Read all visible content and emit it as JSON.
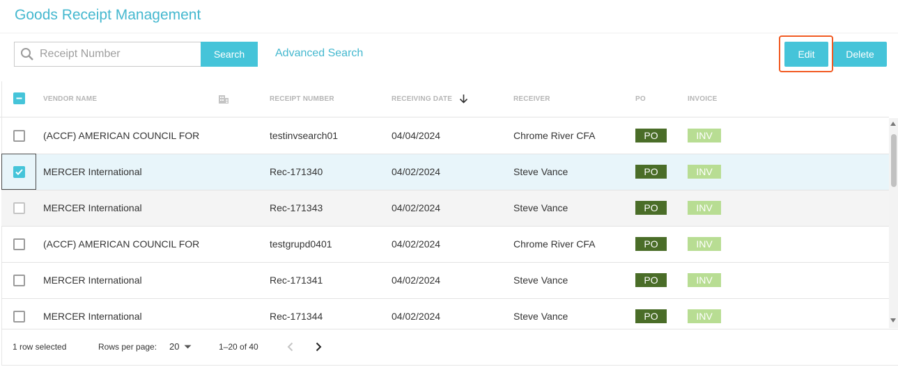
{
  "page": {
    "title": "Goods Receipt Management"
  },
  "toolbar": {
    "search_placeholder": "Receipt Number",
    "search_label": "Search",
    "advanced_search_label": "Advanced Search",
    "edit_label": "Edit",
    "delete_label": "Delete"
  },
  "table": {
    "columns": {
      "vendor": "VENDOR NAME",
      "receipt": "RECEIPT NUMBER",
      "date": "RECEIVING DATE",
      "receiver": "RECEIVER",
      "po": "PO",
      "invoice": "INVOICE"
    },
    "rows": [
      {
        "vendor": "(ACCF) AMERICAN COUNCIL FOR",
        "receipt": "testinvsearch01",
        "date": "04/04/2024",
        "receiver": "Chrome River CFA",
        "po": "PO",
        "inv": "INV",
        "checked": false
      },
      {
        "vendor": "MERCER International",
        "receipt": "Rec-171340",
        "date": "04/02/2024",
        "receiver": "Steve Vance",
        "po": "PO",
        "inv": "INV",
        "checked": true
      },
      {
        "vendor": "MERCER International",
        "receipt": "Rec-171343",
        "date": "04/02/2024",
        "receiver": "Steve Vance",
        "po": "PO",
        "inv": "INV",
        "checked": false
      },
      {
        "vendor": "(ACCF) AMERICAN COUNCIL FOR",
        "receipt": "testgrupd0401",
        "date": "04/02/2024",
        "receiver": "Chrome River CFA",
        "po": "PO",
        "inv": "INV",
        "checked": false
      },
      {
        "vendor": "MERCER International",
        "receipt": "Rec-171341",
        "date": "04/02/2024",
        "receiver": "Steve Vance",
        "po": "PO",
        "inv": "INV",
        "checked": false
      },
      {
        "vendor": "MERCER International",
        "receipt": "Rec-171344",
        "date": "04/02/2024",
        "receiver": "Steve Vance",
        "po": "PO",
        "inv": "INV",
        "checked": false
      }
    ]
  },
  "footer": {
    "selected_text": "1 row selected",
    "rows_per_page_label": "Rows per page:",
    "rows_per_page_value": "20",
    "range_text": "1–20 of 40"
  },
  "colors": {
    "accent": "#45c4d9",
    "title": "#45b8cf",
    "po_badge": "#4a6d28",
    "inv_badge": "#b8dd93",
    "highlight": "#f15a22"
  }
}
